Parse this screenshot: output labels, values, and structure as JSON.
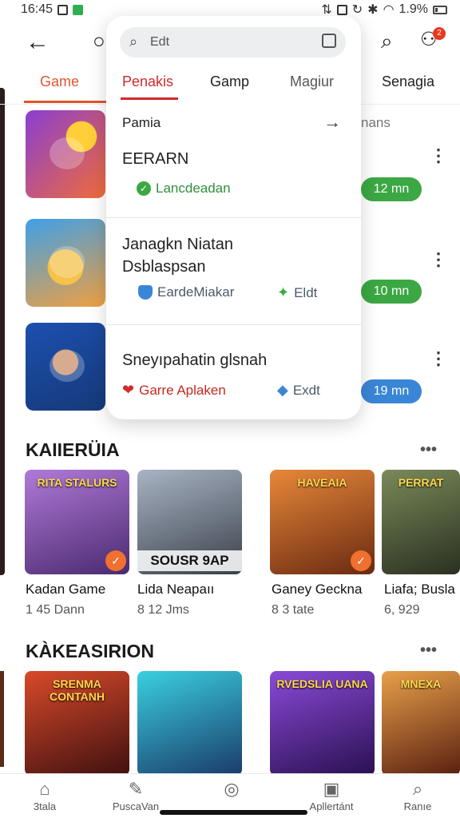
{
  "status": {
    "time": "16:45",
    "battery": "1.9%"
  },
  "topbar": {
    "badge": "2"
  },
  "tabs": {
    "active": "Game",
    "right": "Senagia"
  },
  "list": {
    "peek": "nans",
    "durations": [
      "12 mn",
      "10 mn",
      "19 mn"
    ]
  },
  "popup": {
    "search_placeholder": "Edt",
    "tabs": [
      "Penakis",
      "Gamp",
      "Magiur"
    ],
    "row_label": "Pamia",
    "item1": {
      "title": "EERARN",
      "meta": "Lancdeadan"
    },
    "item2": {
      "title_line1": "Janagkn Niatan",
      "title_line2": "Dsblaspsan",
      "meta_left": "EardeMiakar",
      "meta_right": "Eldt"
    },
    "item3": {
      "title": "Sneyıpahatin glsnah",
      "meta_left": "Garre Aplaken",
      "meta_right": "Exdt"
    }
  },
  "section1": {
    "title": "KAIIERÜIA",
    "cards": [
      {
        "art_title": "RITA STALURS",
        "name": "Kadan Game",
        "info": "1 45 Dann"
      },
      {
        "banner": "SOUSR 9AP",
        "name": "Lida Neapaıı",
        "info": "8 12 Jms"
      },
      {
        "art_title": "HAVEAIA",
        "name": "Ganey Geckna",
        "info": "8 3 tate"
      },
      {
        "art_title": "PERRAT",
        "name": "Liafa; Busla",
        "info": "6, 929"
      }
    ]
  },
  "section2": {
    "title": "KÀKEASIRION",
    "cards": [
      {
        "art_title": "SRENMA CONTANH"
      },
      {
        "art_title": ""
      },
      {
        "art_title": "RVEDSLIA UANA"
      },
      {
        "art_title": "MNEXA"
      }
    ]
  },
  "bottom_nav": [
    "3tala",
    "PuscaVan",
    "",
    "Apllertánt",
    "Ranıe"
  ],
  "colors": {
    "accent": "#e2562d",
    "popup_accent": "#d12a2a",
    "green": "#3ba843",
    "blue": "#3a86d6"
  }
}
